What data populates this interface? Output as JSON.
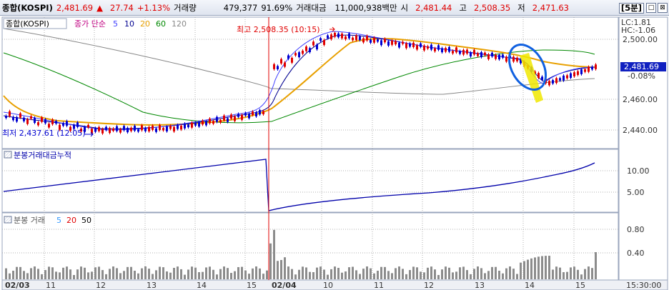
{
  "header": {
    "symbol": "종합(KOSPI)",
    "price": "2,481.69",
    "change_arrow": "▲",
    "change": "27.74",
    "change_pct": "+1.13%",
    "volume_label": "거래량",
    "volume": "479,377",
    "volume_pct": "91.69%",
    "amount_label": "거래대금",
    "amount": "11,000,938백만",
    "open_label": "시",
    "open": "2,481.44",
    "high_label": "고",
    "high": "2,508.35",
    "low_label": "저",
    "low": "2,471.63",
    "interval": "[5분]",
    "minimize_icon": "□",
    "close_icon": "⊠"
  },
  "price_pane": {
    "tag": "종합(KOSPI)",
    "ma_title": "종가 단순",
    "ma_periods": [
      "5",
      "10",
      "20",
      "60",
      "120"
    ],
    "ma_colors": [
      "#4040ff",
      "#000090",
      "#e8a000",
      "#008800",
      "#888888"
    ],
    "max_label": "최고 2,508.35 (10:15)",
    "min_label": "최저 2,437.61 (12:05)",
    "lc": "LC:1.81",
    "hc": "HC:-1.06",
    "current": "2,481.69",
    "current_pct": "-0.08%",
    "y_ticks": [
      "2,500.00",
      "2,460.00",
      "2,440.00"
    ]
  },
  "amount_pane": {
    "title": "분봉거래대금누적",
    "y_ticks": [
      "10.00",
      "5.00"
    ]
  },
  "volume_pane": {
    "title": "분봉 거래",
    "ma_periods": [
      "5",
      "20",
      "50"
    ],
    "ma_colors": [
      "#3399ff",
      "#e00000",
      "#000000"
    ],
    "y_ticks": [
      "0.80",
      "0.40"
    ]
  },
  "x_axis": {
    "labels": [
      "02/03",
      "11",
      "12",
      "13",
      "14",
      "15",
      "02/04",
      "10",
      "11",
      "12",
      "13",
      "14",
      "15"
    ],
    "time_label": "15:30:00"
  },
  "colors": {
    "up": "#e00000",
    "down": "#0000d0",
    "grid": "#b0b0b0",
    "highlight": "#f0e800",
    "circle": "#1060e0",
    "line": "#0000aa"
  }
}
